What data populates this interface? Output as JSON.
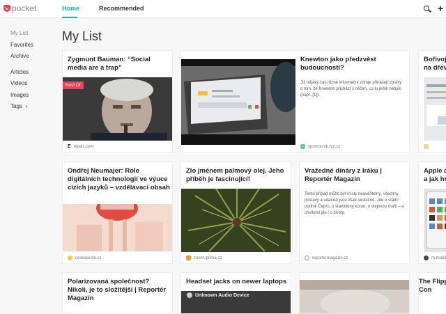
{
  "app": {
    "logo_text": "pocket"
  },
  "nav": {
    "home": "Home",
    "recommended": "Recommended"
  },
  "sidebar": {
    "items": [
      {
        "label": "My List"
      },
      {
        "label": "Favorites"
      },
      {
        "label": "Archive"
      },
      {
        "label": "Articles"
      },
      {
        "label": "Videos"
      },
      {
        "label": "Images"
      },
      {
        "label": "Tags"
      }
    ]
  },
  "page": {
    "title": "My List"
  },
  "cards": [
    {
      "title": "Zygmunt Bauman: “Social media are a trap”",
      "badge": "Best Of",
      "source": "elpais.com"
    },
    {
      "title": "Knewton jako předzvěst budoucnosti?",
      "excerpt": "Již nějaký čas různé informační zdroje přinášejí zprávy o tom, že Knewton přichází s něčím, co tu ještě nebylo (např. [1]).",
      "source": "spomocnik.rvp.cz"
    },
    {
      "title": "Bořivoj … na dřev…",
      "source": ""
    },
    {
      "title": "Ondřej Neumajer: Role digitálních technologií ve výuce cizích jazyků – vzdělávací obsah",
      "source": "ceskaskola.cz"
    },
    {
      "title": "Zlo jménem palmový olej. Jeho příběh je fascinující!",
      "source": "zoom.iprima.cz"
    },
    {
      "title": "Vražedné dínáry z Iráku | Reportér Magazín",
      "excerpt": "Tento případ může být místy neuvěřitelný, všechny postavy a události jsou však skutečné. Jde o státní podnik Čepro, o stamiliony korun, o olejovou mafii – a chvílemi jde i o životy.",
      "source": "reportermagazin.cz"
    },
    {
      "title": "Apple a … a jak ho…",
      "source": "m.mobil…"
    },
    {
      "title": "Polarizovaná společnost? Nikoli, je to složitější | Reportér Magazín",
      "source": ""
    },
    {
      "title": "Headset jacks on newer laptops",
      "source": ""
    },
    {
      "title": "",
      "source": ""
    },
    {
      "title": "The Flipp… Con",
      "source": ""
    }
  ],
  "thumb_text": {
    "audio_device": "Unknown Audio Device"
  }
}
